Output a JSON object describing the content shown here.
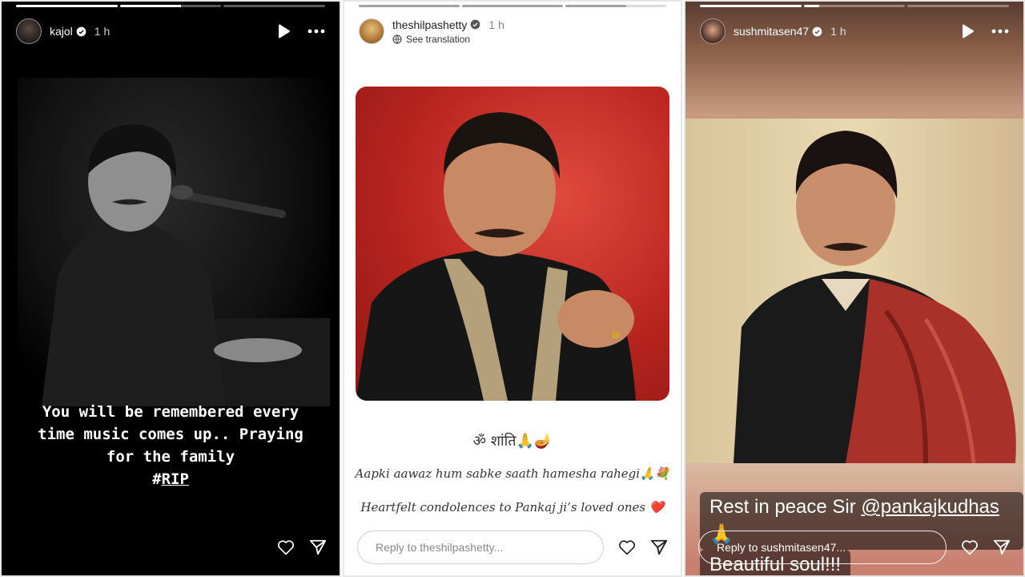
{
  "stories": [
    {
      "username": "kajol",
      "time": "1 h",
      "progress": [
        1,
        0.6,
        0
      ],
      "caption_line1": "You will be remembered every",
      "caption_line2": "time music comes up.. Praying",
      "caption_line3": "for the family",
      "caption_hash": "#",
      "caption_tag": "RIP"
    },
    {
      "username": "theshilpashetty",
      "time": "1 h",
      "translation": "See translation",
      "progress": [
        1,
        1,
        0.6
      ],
      "line1": "ॐ शांति🙏🪔",
      "line2": "Aapki aawaz hum sabke saath hamesha rahegi🙏💐",
      "line3": "Heartfelt condolences to Pankaj ji’s loved ones ❤️",
      "reply_placeholder": "Reply to theshilpashetty..."
    },
    {
      "username": "sushmitasen47",
      "time": "1 h",
      "progress": [
        1,
        0.15,
        0
      ],
      "caption_prefix": "Rest in peace Sir ",
      "caption_mention": "@pankajkudhas",
      "caption_emoji": " 🙏",
      "caption_line2": "Beautiful soul!!!",
      "reply_placeholder": "Reply to sushmitasen47..."
    }
  ]
}
